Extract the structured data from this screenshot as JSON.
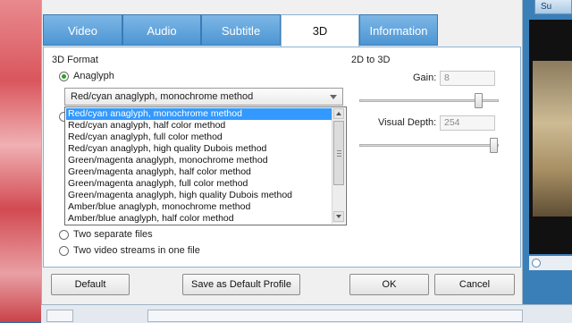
{
  "preview": {
    "tab_label": "Su"
  },
  "tabs": [
    {
      "label": "Video"
    },
    {
      "label": "Audio"
    },
    {
      "label": "Subtitle"
    },
    {
      "label": "3D"
    },
    {
      "label": "Information"
    }
  ],
  "active_tab": "3D",
  "format": {
    "section_label": "3D Format",
    "anaglyph_label": "Anaglyph",
    "selected_value": "Red/cyan anaglyph, monochrome method",
    "options": [
      "Red/cyan anaglyph, monochrome method",
      "Red/cyan anaglyph, half color method",
      "Red/cyan anaglyph, full color method",
      "Red/cyan anaglyph, high quality Dubois method",
      "Green/magenta anaglyph, monochrome method",
      "Green/magenta anaglyph, half color method",
      "Green/magenta anaglyph, full color method",
      "Green/magenta anaglyph, high quality Dubois method",
      "Amber/blue anaglyph, monochrome method",
      "Amber/blue anaglyph, half color method"
    ],
    "two_files_label": "Two separate files",
    "two_streams_label": "Two video streams in one file"
  },
  "conversion": {
    "section_label": "2D to 3D",
    "gain_label": "Gain:",
    "gain_value": "8",
    "gain_level": 0.88,
    "depth_label": "Visual Depth:",
    "depth_value": "254",
    "depth_level": 0.99
  },
  "buttons": {
    "default": "Default",
    "save_default": "Save as Default Profile",
    "ok": "OK",
    "cancel": "Cancel"
  },
  "colors": {
    "tab_blue": "#4d96d3",
    "selection": "#3399ff",
    "radio_green": "#2aa12a"
  }
}
